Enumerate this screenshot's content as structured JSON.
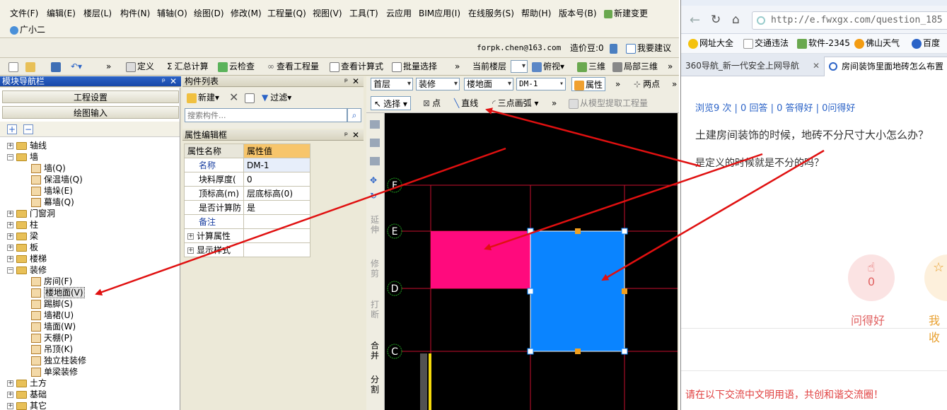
{
  "app": {
    "menu": [
      "文件(F)",
      "编辑(E)",
      "楼层(L)",
      "构件(N)",
      "辅轴(O)",
      "绘图(D)",
      "修改(M)",
      "工程量(Q)",
      "视图(V)",
      "工具(T)",
      "云应用",
      "BIM应用(I)",
      "在线服务(S)",
      "帮助(H)",
      "版本号(B)",
      "新建变更"
    ],
    "assistant": "广小二",
    "user_email": "forpk.chen@163.com",
    "price_beans": "造价豆:0",
    "feedback": "我要建议",
    "toolbar": [
      "定义",
      "汇总计算",
      "云检查",
      "查看工程量",
      "查看计算式",
      "批量选择"
    ],
    "current_floor_label": "当前楼层",
    "view_items": [
      "俯视",
      "三维",
      "局部三维"
    ],
    "draw_toolbar": {
      "floor": "首层",
      "category": "装修",
      "type": "楼地面",
      "element": "DM-1",
      "properties": "属性",
      "two_point": "两点",
      "select": "选择",
      "point": "点",
      "line": "直线",
      "arc": "三点画弧",
      "extract": "从模型提取工程量"
    },
    "nav": {
      "title": "模块导航栏",
      "buttons": [
        "工程设置",
        "绘图输入"
      ],
      "tree": [
        {
          "label": "轴线",
          "type": "folder",
          "expanded": false,
          "level": 0
        },
        {
          "label": "墙",
          "type": "folder",
          "expanded": true,
          "level": 0
        },
        {
          "label": "墙(Q)",
          "type": "leaf",
          "level": 1
        },
        {
          "label": "保温墙(Q)",
          "type": "leaf",
          "level": 1
        },
        {
          "label": "墙垛(E)",
          "type": "leaf",
          "level": 1
        },
        {
          "label": "幕墙(Q)",
          "type": "leaf",
          "level": 1
        },
        {
          "label": "门窗洞",
          "type": "folder",
          "expanded": false,
          "level": 0
        },
        {
          "label": "柱",
          "type": "folder",
          "expanded": false,
          "level": 0
        },
        {
          "label": "梁",
          "type": "folder",
          "expanded": false,
          "level": 0
        },
        {
          "label": "板",
          "type": "folder",
          "expanded": false,
          "level": 0
        },
        {
          "label": "楼梯",
          "type": "folder",
          "expanded": false,
          "level": 0
        },
        {
          "label": "装修",
          "type": "folder",
          "expanded": true,
          "level": 0
        },
        {
          "label": "房间(F)",
          "type": "leaf",
          "level": 1
        },
        {
          "label": "楼地面(V)",
          "type": "leaf",
          "level": 1,
          "selected": true
        },
        {
          "label": "踢脚(S)",
          "type": "leaf",
          "level": 1
        },
        {
          "label": "墙裙(U)",
          "type": "leaf",
          "level": 1
        },
        {
          "label": "墙面(W)",
          "type": "leaf",
          "level": 1
        },
        {
          "label": "天棚(P)",
          "type": "leaf",
          "level": 1
        },
        {
          "label": "吊顶(K)",
          "type": "leaf",
          "level": 1
        },
        {
          "label": "独立柱装修",
          "type": "leaf",
          "level": 1
        },
        {
          "label": "单梁装修",
          "type": "leaf",
          "level": 1
        },
        {
          "label": "土方",
          "type": "folder",
          "expanded": false,
          "level": 0
        },
        {
          "label": "基础",
          "type": "folder",
          "expanded": false,
          "level": 0
        },
        {
          "label": "其它",
          "type": "folder",
          "expanded": false,
          "level": 0
        }
      ]
    },
    "component_list": {
      "title": "构件列表",
      "new_label": "新建",
      "filter_label": "过滤",
      "search_placeholder": "搜索构件..."
    },
    "property_editor": {
      "title": "属性编辑框",
      "header_name": "属性名称",
      "header_value": "属性值",
      "rows": [
        {
          "name": "名称",
          "value": "DM-1"
        },
        {
          "name": "块料厚度(",
          "value": "0"
        },
        {
          "name": "顶标高(m)",
          "value": "层底标高(0)"
        },
        {
          "name": "是否计算防",
          "value": "是"
        },
        {
          "name": "备注",
          "value": ""
        },
        {
          "name": "计算属性",
          "value": "",
          "expandable": true
        },
        {
          "name": "显示样式",
          "value": "",
          "expandable": true
        }
      ]
    },
    "vertical_tools": [
      "延伸",
      "修剪",
      "打断",
      "合并",
      "分割"
    ],
    "axis_labels": [
      "F",
      "E",
      "D",
      "C"
    ],
    "colors": {
      "magenta": "#ff0a7d",
      "blue": "#0a84ff",
      "grid": "#c8102e",
      "arrow": "#e01010"
    }
  },
  "browser": {
    "url": "http://e.fwxgx.com/question_185",
    "bookmarks": [
      "网址大全",
      "交通违法",
      "软件-2345",
      "佛山天气",
      "百度"
    ],
    "tabs": [
      "360导航_新一代安全上网导航",
      "房间装饰里面地砖怎么布置"
    ],
    "stats": "浏览9 次 | 0 回答 | 0 答得好 | 0问得好",
    "question": "土建房间装饰的时候，地砖不分尺寸大小怎么办？",
    "detail": "是定义的时候就是不分的吗？",
    "like_count": "0",
    "like_label": "问得好",
    "collect_label": "我收",
    "notice": "请在以下交流中文明用语，共创和谐交流圈！"
  }
}
